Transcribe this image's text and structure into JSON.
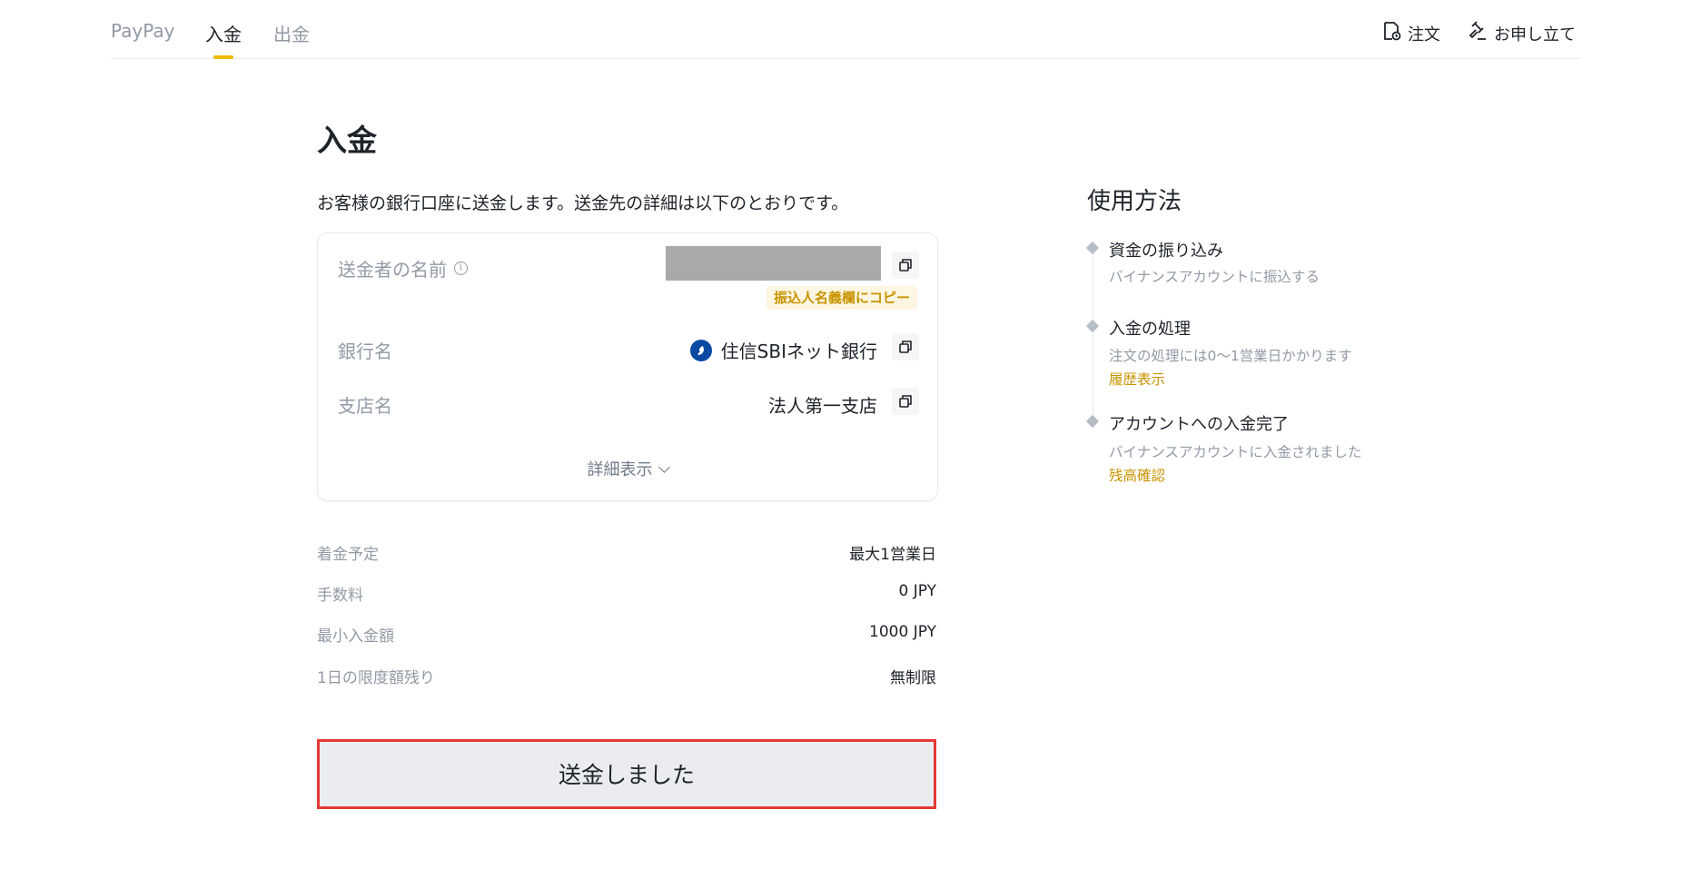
{
  "nav": {
    "tabs": [
      {
        "label": "PayPay",
        "active": false
      },
      {
        "label": "入金",
        "active": true
      },
      {
        "label": "出金",
        "active": false
      }
    ],
    "actions": {
      "orders_label": "注文",
      "orders_icon": "order-history-icon",
      "appeal_label": "お申し立て",
      "appeal_icon": "gavel-icon"
    }
  },
  "main": {
    "title": "入金",
    "intro": "お客様の銀行口座に送金します。送金先の詳細は以下のとおりです。",
    "card": {
      "sender_name_label": "送金者の名前",
      "copy_name_chip": "振込人名義欄にコピー",
      "bank_name_label": "銀行名",
      "bank_name_value": "住信SBIネット銀行",
      "branch_label": "支店名",
      "branch_value": "法人第一支店",
      "details_toggle": "詳細表示"
    },
    "summary": [
      {
        "label": "着金予定",
        "value": "最大1営業日"
      },
      {
        "label": "手数料",
        "value": "0 JPY"
      },
      {
        "label": "最小入金額",
        "value": "1000 JPY"
      },
      {
        "label": "1日の限度額残り",
        "value": "無制限"
      }
    ],
    "submit_label": "送金しました"
  },
  "guide": {
    "title": "使用方法",
    "steps": [
      {
        "title": "資金の振り込み",
        "desc": "バイナンスアカウントに振込する",
        "link": ""
      },
      {
        "title": "入金の処理",
        "desc": "注文の処理には0〜1営業日かかります",
        "link": "履歴表示"
      },
      {
        "title": "アカウントへの入金完了",
        "desc": "バイナンスアカウントに入金されました",
        "link": "残高確認"
      }
    ]
  },
  "colors": {
    "accent": "#F0B90B",
    "link": "#C99400",
    "highlight_border": "#E53935",
    "muted_text": "#929AA5"
  }
}
